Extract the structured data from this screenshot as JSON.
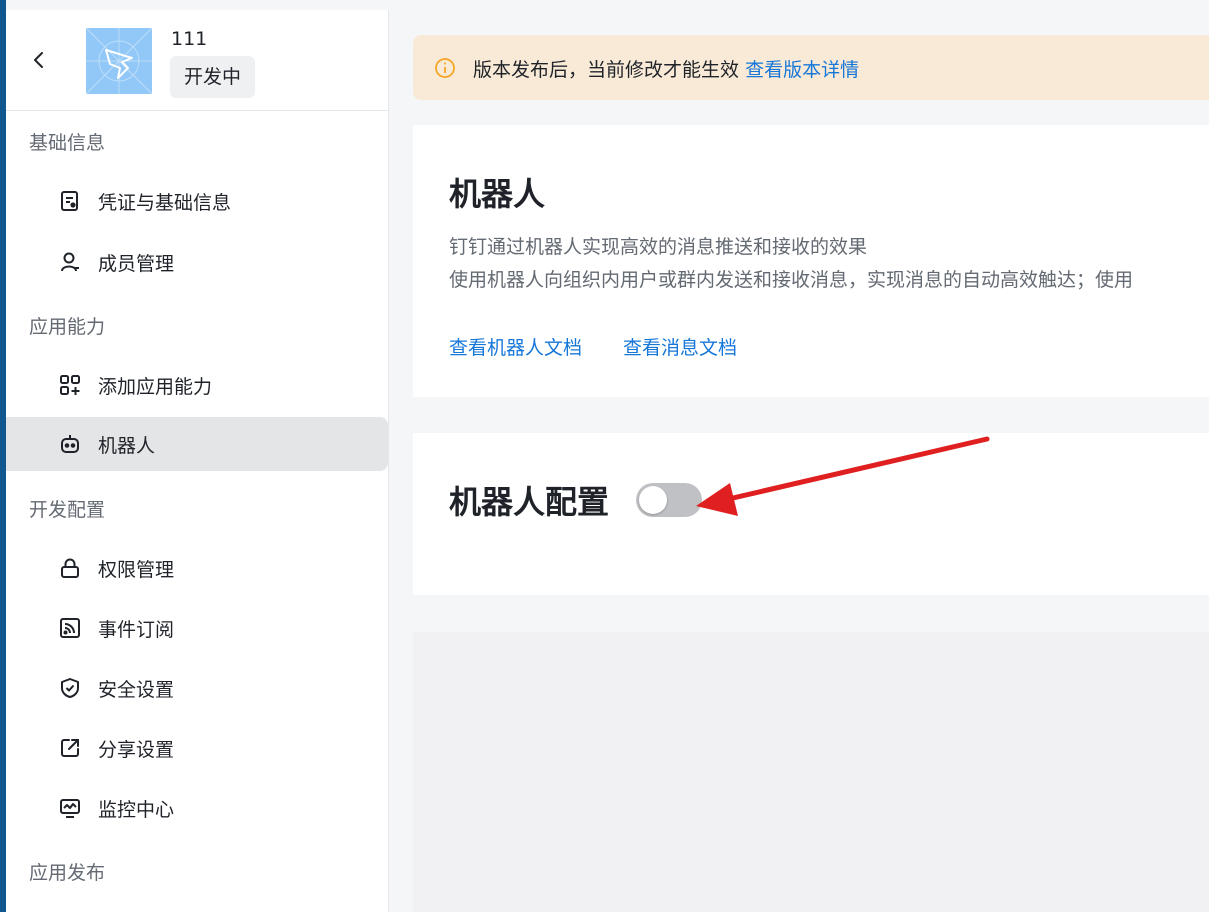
{
  "app": {
    "name": "111",
    "status": "开发中"
  },
  "sidebar": {
    "groups": [
      {
        "title": "基础信息"
      },
      {
        "title": "应用能力"
      },
      {
        "title": "开发配置"
      },
      {
        "title": "应用发布"
      }
    ],
    "items": [
      {
        "label": "凭证与基础信息",
        "icon": "credential-icon"
      },
      {
        "label": "成员管理",
        "icon": "user-icon"
      },
      {
        "label": "添加应用能力",
        "icon": "add-capability-icon"
      },
      {
        "label": "机器人",
        "icon": "robot-icon",
        "active": true
      },
      {
        "label": "权限管理",
        "icon": "lock-icon"
      },
      {
        "label": "事件订阅",
        "icon": "rss-icon"
      },
      {
        "label": "安全设置",
        "icon": "shield-icon"
      },
      {
        "label": "分享设置",
        "icon": "share-icon"
      },
      {
        "label": "监控中心",
        "icon": "monitor-icon"
      }
    ]
  },
  "banner": {
    "text": "版本发布后，当前修改才能生效",
    "link": "查看版本详情"
  },
  "robot_card": {
    "title": "机器人",
    "desc1": "钉钉通过机器人实现高效的消息推送和接收的效果",
    "desc2": "使用机器人向组织内用户或群内发送和接收消息，实现消息的自动高效触达；使用",
    "link1": "查看机器人文档",
    "link2": "查看消息文档"
  },
  "config_card": {
    "title": "机器人配置",
    "toggle_on": false
  },
  "colors": {
    "accent": "#1677d9",
    "banner_bg": "#f8ead6",
    "warning": "#f5a623",
    "arrow": "#e02020",
    "sidebar_edge": "#11578f"
  }
}
